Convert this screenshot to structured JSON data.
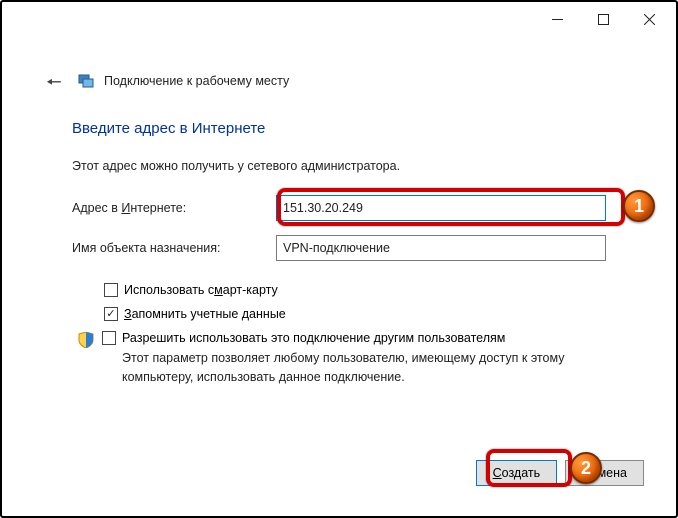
{
  "window": {
    "title": "Подключение к рабочему месту"
  },
  "heading": "Введите адрес в Интернете",
  "subtext": "Этот адрес можно получить у сетевого администратора.",
  "fields": {
    "address_label_pre": "Адрес в ",
    "address_label_u": "И",
    "address_label_post": "нтернете:",
    "address_value": "151.30.20.249",
    "dest_label": "Имя объекта назначения:",
    "dest_value": "VPN-подключение"
  },
  "options": {
    "smartcard_pre": "Использовать с",
    "smartcard_u": "м",
    "smartcard_post": "арт-карту",
    "remember_u": "З",
    "remember_post": "апомнить учетные данные",
    "allow_others": "Разрешить использовать это подключение другим пользователям",
    "allow_help": "Этот параметр позволяет любому пользователю, имеющему доступ к этому компьютеру, использовать данное подключение."
  },
  "buttons": {
    "create_u": "С",
    "create_post": "оздать",
    "cancel": "Отмена"
  },
  "annotations": {
    "badge1": "1",
    "badge2": "2"
  }
}
